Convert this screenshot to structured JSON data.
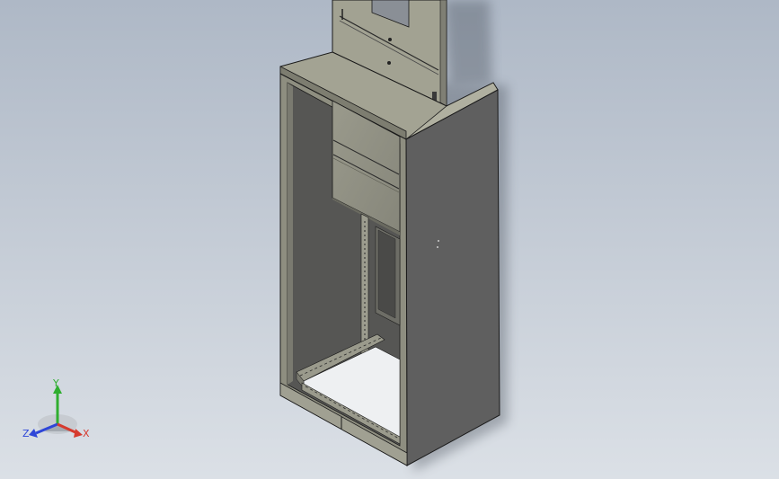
{
  "viewport": {
    "background_top": "#aeb8c6",
    "background_bottom": "#dbe0e6"
  },
  "model": {
    "subject": "cabinet-enclosure-3d-model",
    "colors": {
      "panel_face": "#8e8e80",
      "panel_top": "#a3a393",
      "side_dark": "#5f5f5f",
      "inner_shadow": "#4e4e4c",
      "floor": "#eef0f2",
      "edge": "#1a1a1a"
    }
  },
  "triad": {
    "axes": [
      {
        "label": "Y",
        "color": "#2fae2f"
      },
      {
        "label": "Z",
        "color": "#2e46d8"
      },
      {
        "label": "X",
        "color": "#d63a2e"
      }
    ]
  }
}
